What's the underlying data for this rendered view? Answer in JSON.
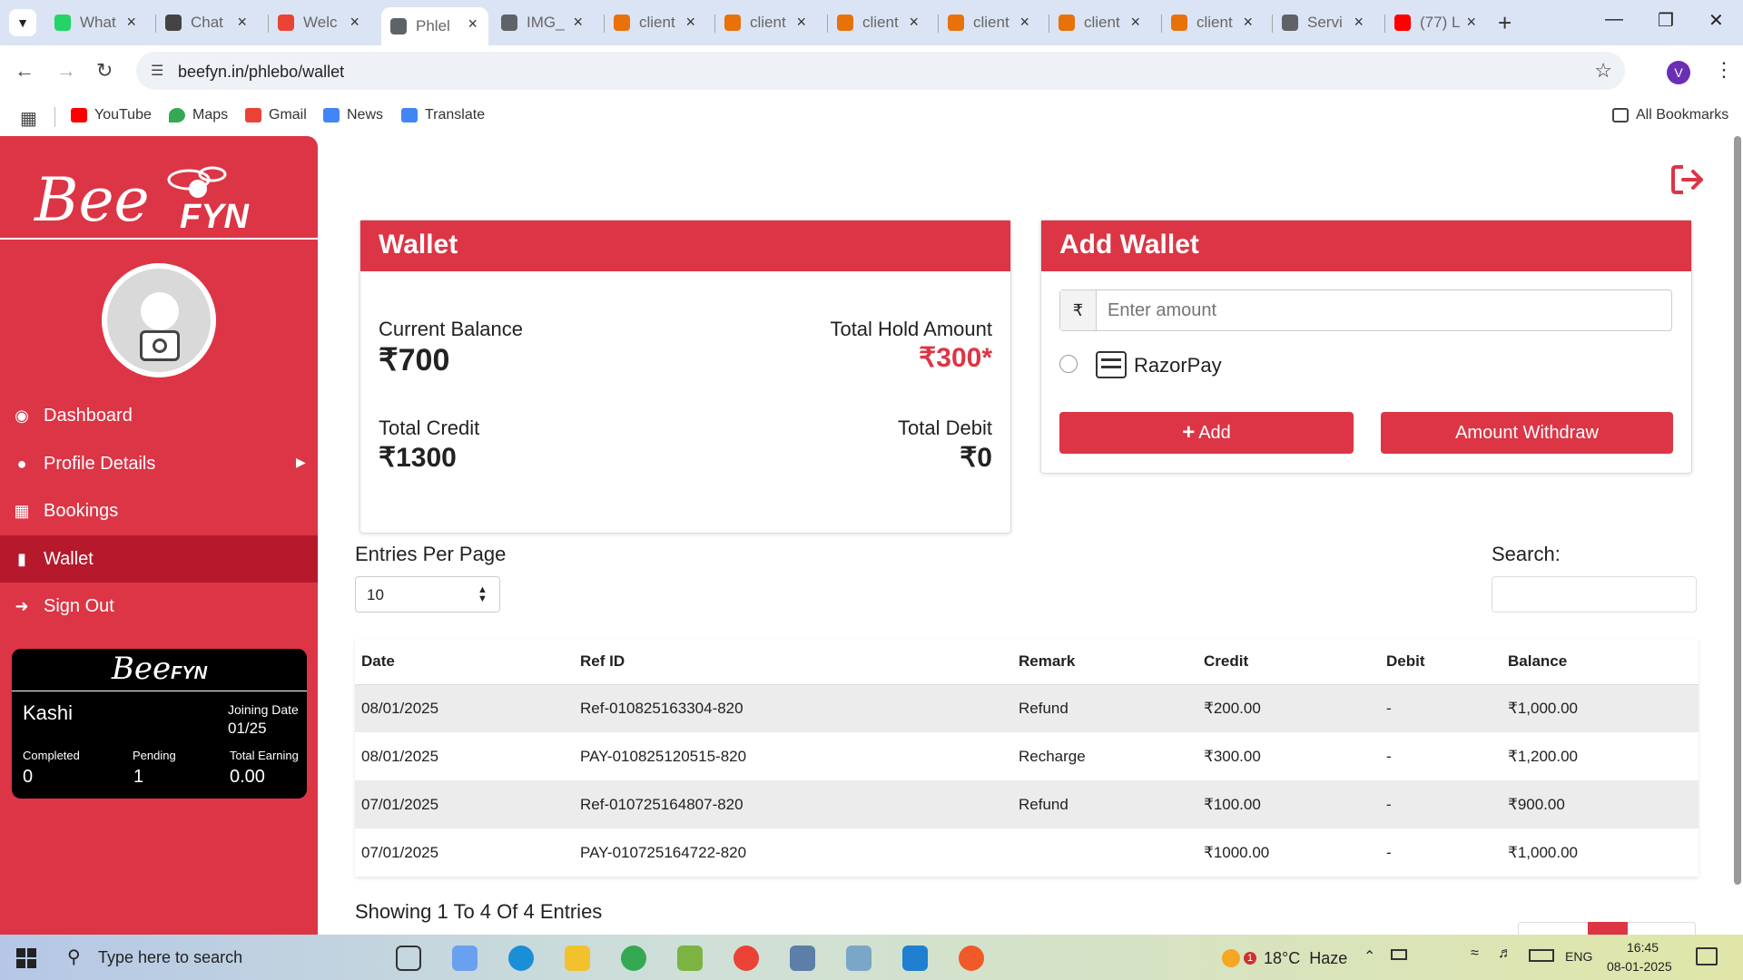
{
  "browser": {
    "tabs": [
      {
        "title": "What",
        "color": "#25d366"
      },
      {
        "title": "Chat",
        "color": "#444"
      },
      {
        "title": "Welc",
        "color": "#ea4335"
      },
      {
        "title": "Phlel",
        "color": "#5f6368"
      },
      {
        "title": "IMG_",
        "color": "#5f6368"
      },
      {
        "title": "client",
        "color": "#e8710a"
      },
      {
        "title": "client",
        "color": "#e8710a"
      },
      {
        "title": "client",
        "color": "#e8710a"
      },
      {
        "title": "client",
        "color": "#e8710a"
      },
      {
        "title": "client",
        "color": "#e8710a"
      },
      {
        "title": "client",
        "color": "#e8710a"
      },
      {
        "title": "Servi",
        "color": "#5f6368"
      },
      {
        "title": "(77) L",
        "color": "#ff0000"
      }
    ],
    "url": "beefyn.in/phlebo/wallet",
    "profile_initial": "V",
    "bookmarks": [
      "YouTube",
      "Maps",
      "Gmail",
      "News",
      "Translate"
    ],
    "all_bookmarks": "All Bookmarks"
  },
  "sidebar": {
    "logo_script": "Bee",
    "logo_brand": "FYN",
    "items": [
      {
        "label": "Dashboard",
        "icon": "palette-icon"
      },
      {
        "label": "Profile Details",
        "icon": "user-icon"
      },
      {
        "label": "Bookings",
        "icon": "calendar-icon"
      },
      {
        "label": "Wallet",
        "icon": "wallet-icon"
      },
      {
        "label": "Sign Out",
        "icon": "sign-out-icon"
      }
    ],
    "active": "Wallet",
    "card": {
      "name": "Kashi",
      "joining_label": "Joining Date",
      "joining_value": "01/25",
      "stats": [
        {
          "label": "Completed",
          "value": "0"
        },
        {
          "label": "Pending",
          "value": "1"
        },
        {
          "label": "Total Earning",
          "value": "0.00"
        }
      ]
    }
  },
  "wallet": {
    "title": "Wallet",
    "current_balance_label": "Current Balance",
    "current_balance": "₹700",
    "hold_label": "Total Hold Amount",
    "hold_value": "₹300*",
    "credit_label": "Total Credit",
    "credit_value": "₹1300",
    "debit_label": "Total Debit",
    "debit_value": "₹0"
  },
  "add_wallet": {
    "title": "Add Wallet",
    "currency_symbol": "₹",
    "amount_placeholder": "Enter amount",
    "payment_option": "RazorPay",
    "add_button": "Add",
    "withdraw_button": "Amount Withdraw"
  },
  "table_controls": {
    "entries_label": "Entries Per Page",
    "entries_value": "10",
    "search_label": "Search:",
    "footer": "Showing 1 To 4 Of 4 Entries"
  },
  "table": {
    "columns": [
      "Date",
      "Ref ID",
      "Remark",
      "Credit",
      "Debit",
      "Balance"
    ],
    "rows": [
      [
        "08/01/2025",
        "Ref-010825163304-820",
        "Refund",
        "₹200.00",
        "-",
        "₹1,000.00"
      ],
      [
        "08/01/2025",
        "PAY-010825120515-820",
        "Recharge",
        "₹300.00",
        "-",
        "₹1,200.00"
      ],
      [
        "07/01/2025",
        "Ref-010725164807-820",
        "Refund",
        "₹100.00",
        "-",
        "₹900.00"
      ],
      [
        "07/01/2025",
        "PAY-010725164722-820",
        "",
        "₹1000.00",
        "-",
        "₹1,000.00"
      ]
    ]
  },
  "taskbar": {
    "search_placeholder": "Type here to search",
    "weather_badge": "1",
    "weather": "18°C  Haze",
    "language": "ENG",
    "time": "16:45",
    "date": "08-01-2025"
  }
}
